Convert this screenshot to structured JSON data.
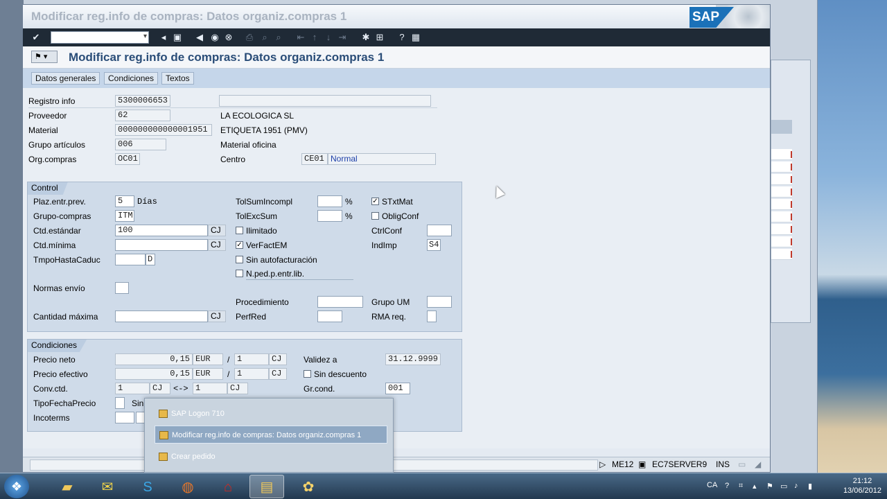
{
  "window": {
    "title": "Modificar reg.info de compras: Datos organiz.compras 1",
    "logo": "SAP"
  },
  "app_title": "Modificar reg.info de compras: Datos organiz.compras 1",
  "tabs": [
    {
      "label": "Datos generales"
    },
    {
      "label": "Condiciones"
    },
    {
      "label": "Textos"
    }
  ],
  "header": {
    "registro_info_label": "Registro info",
    "registro_info_value": "5300006653",
    "proveedor_label": "Proveedor",
    "proveedor_value": "62",
    "proveedor_name": "LA ECOLOGICA SL",
    "material_label": "Material",
    "material_value": "000000000000001951",
    "material_desc": "ETIQUETA 1951 (PMV)",
    "grupo_articulos_label": "Grupo artículos",
    "grupo_articulos_value": "006",
    "grupo_articulos_desc": "Material oficina",
    "org_compras_label": "Org.compras",
    "org_compras_value": "OC01",
    "centro_label": "Centro",
    "centro_value": "CE01",
    "centro_desc": "Normal"
  },
  "control": {
    "title": "Control",
    "plaz_label": "Plaz.entr.prev.",
    "plaz_value": "5",
    "plaz_unit": "Días",
    "grupo_compras_label": "Grupo-compras",
    "grupo_compras_value": "ITM",
    "ctd_estandar_label": "Ctd.estándar",
    "ctd_estandar_value": "100",
    "ctd_estandar_unit": "CJ",
    "ctd_minima_label": "Ctd.mínima",
    "ctd_minima_value": "",
    "ctd_minima_unit": "CJ",
    "tmpo_label": "TmpoHastaCaduc",
    "tmpo_value": "",
    "tmpo_unit": "D",
    "normas_label": "Normas envío",
    "normas_value": "",
    "cantidad_max_label": "Cantidad máxima",
    "cantidad_max_value": "",
    "cantidad_max_unit": "CJ",
    "tolsum_label": "TolSumIncompl",
    "tolsum_value": "",
    "tolsum_unit": "%",
    "tolexc_label": "TolExcSum",
    "tolexc_value": "",
    "tolexc_unit": "%",
    "ilimitado_label": "Ilimitado",
    "ilimitado_checked": false,
    "verfact_label": "VerFactEM",
    "verfact_checked": true,
    "sinauto_label": "Sin autofacturación",
    "sinauto_checked": false,
    "nped_label": "N.ped.p.entr.lib.",
    "nped_checked": false,
    "procedimiento_label": "Procedimiento",
    "procedimiento_value": "",
    "perfred_label": "PerfRed",
    "perfred_value": "",
    "stxtmat_label": "STxtMat",
    "stxtmat_checked": true,
    "obligconf_label": "ObligConf",
    "obligconf_checked": false,
    "ctrlconf_label": "CtrlConf",
    "ctrlconf_value": "",
    "indimp_label": "IndImp",
    "indimp_value": "S4",
    "grupoum_label": "Grupo UM",
    "grupoum_value": "",
    "rma_label": "RMA req.",
    "rma_value": ""
  },
  "condiciones": {
    "title": "Condiciones",
    "precio_neto_label": "Precio neto",
    "precio_neto_value": "0,15",
    "precio_neto_cur": "EUR",
    "precio_neto_per": "1",
    "precio_neto_unit": "CJ",
    "precio_efectivo_label": "Precio efectivo",
    "precio_efectivo_value": "0,15",
    "precio_efectivo_cur": "EUR",
    "precio_efectivo_per": "1",
    "precio_efectivo_unit": "CJ",
    "slash": "/",
    "conv_label": "Conv.ctd.",
    "conv_left": "1",
    "conv_left_unit": "CJ",
    "conv_arrow": "<->",
    "conv_right": "1",
    "conv_right_unit": "CJ",
    "tipofecha_label": "TipoFechaPrecio",
    "tipofecha_value": "",
    "tipofecha_partial": "Sin",
    "incoterms_label": "Incoterms",
    "validez_label": "Validez a",
    "validez_value": "31.12.9999",
    "sindesc_label": "Sin descuento",
    "sindesc_checked": false,
    "grcond_label": "Gr.cond.",
    "grcond_value": "001"
  },
  "statusbar": {
    "transaction": "ME12",
    "server": "EC7SERVER9",
    "mode": "INS"
  },
  "popup": {
    "items": [
      {
        "label": "SAP Logon 710"
      },
      {
        "label": "Modificar reg.info de compras: Datos organiz.compras 1"
      },
      {
        "label": "Crear pedido"
      }
    ]
  },
  "tray": {
    "lang": "CA",
    "time": "21:12",
    "date": "13/06/2012"
  }
}
